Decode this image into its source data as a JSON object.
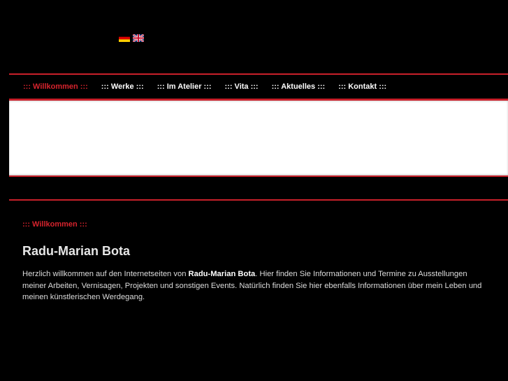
{
  "flags": [
    {
      "name": "german-flag-icon"
    },
    {
      "name": "uk-flag-icon"
    }
  ],
  "nav": {
    "items": [
      {
        "label": "::: Willkommen :::",
        "active": true
      },
      {
        "label": "::: Werke :::",
        "active": false
      },
      {
        "label": "::: Im Atelier :::",
        "active": false
      },
      {
        "label": "::: Vita :::",
        "active": false
      },
      {
        "label": "::: Aktuelles :::",
        "active": false
      },
      {
        "label": "::: Kontakt :::",
        "active": false
      }
    ]
  },
  "colors": {
    "accent": "#d6232d",
    "background": "#000000",
    "banner": "#ffffff"
  },
  "main": {
    "section_label": "::: Willkommen :::",
    "heading": "Radu-Marian Bota",
    "intro_before": "Herzlich willkommen auf den Internetseiten von ",
    "intro_name": "Radu-Marian Bota",
    "intro_after": ". Hier finden Sie Informationen und Termine zu Ausstellungen meiner Arbeiten,  Vernisagen, Projekten und sonstigen Events. Natürlich finden Sie hier ebenfalls Informationen über mein Leben und meinen künstlerischen Werdegang."
  }
}
